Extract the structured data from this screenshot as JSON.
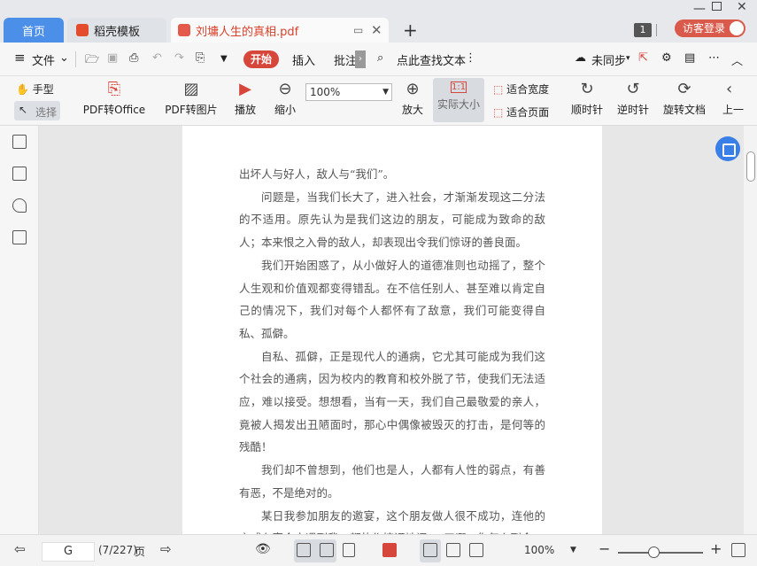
{
  "tabs": {
    "home": "首页",
    "docer": "稻壳模板",
    "pdf": "刘墉人生的真相.pdf"
  },
  "window": {
    "badge": "1",
    "login": "访客登录"
  },
  "menu": {
    "file": "文件",
    "start": "开始",
    "insert": "插入",
    "annotate": "批注",
    "search": "点此查找文本",
    "sync": "未同步"
  },
  "ribbon": {
    "hand": "手型",
    "select": "选择",
    "pdf_to_office": "PDF转Office",
    "pdf_to_image": "PDF转图片",
    "play": "播放",
    "zoom_out": "缩小",
    "zoom_value": "100%",
    "zoom_in": "放大",
    "actual_size": "实际大小",
    "actual_size_icon": "1:1",
    "fit_width": "适合宽度",
    "fit_page": "适合页面",
    "clockwise": "顺时针",
    "counterclockwise": "逆时针",
    "rotate_doc": "旋转文档",
    "prev": "上一"
  },
  "document": {
    "paragraphs": [
      {
        "text": "出坏人与好人，敌人与“我们”。",
        "indent": false
      },
      {
        "text": "问题是，当我们长大了，进入社会，才渐渐发现这二分法的不适用。原先认为是我们这边的朋友，可能成为致命的敌人；本来恨之入骨的敌人，却表现出令我们惊讶的善良面。",
        "indent": true
      },
      {
        "text": "我们开始困惑了，从小做好人的道德准则也动摇了，整个人生观和价值观都变得错乱。在不信任别人、甚至难以肯定自己的情况下，我们对每个人都怀有了敌意，我们可能变得自私、孤僻。",
        "indent": true
      },
      {
        "text": "自私、孤僻，正是现代人的通病，它尤其可能成为我们这个社会的通病，因为校内的教育和校外脱了节，使我们无法适应，难以接受。想想看，当有一天，我们自己最敬爱的亲人，竟被人揭发出丑陋面时，那心中偶像被毁灭的打击，是何等的残酷！",
        "indent": true
      },
      {
        "text": "我们却不曾想到，他们也是人，人都有人性的弱点，有善有恶，不是绝对的。",
        "indent": true
      },
      {
        "text": "某日我参加朋友的邀宴，这个朋友做人很不成功，连他的亲戚在宴会中遇到我，都故作惊讶地问：“天哪，你怎么到今",
        "indent": true
      }
    ]
  },
  "status": {
    "page_input": "G",
    "page_count": "(7/227)",
    "page_unit": "页",
    "zoom": "100%",
    "zoom_level": 0.42
  }
}
